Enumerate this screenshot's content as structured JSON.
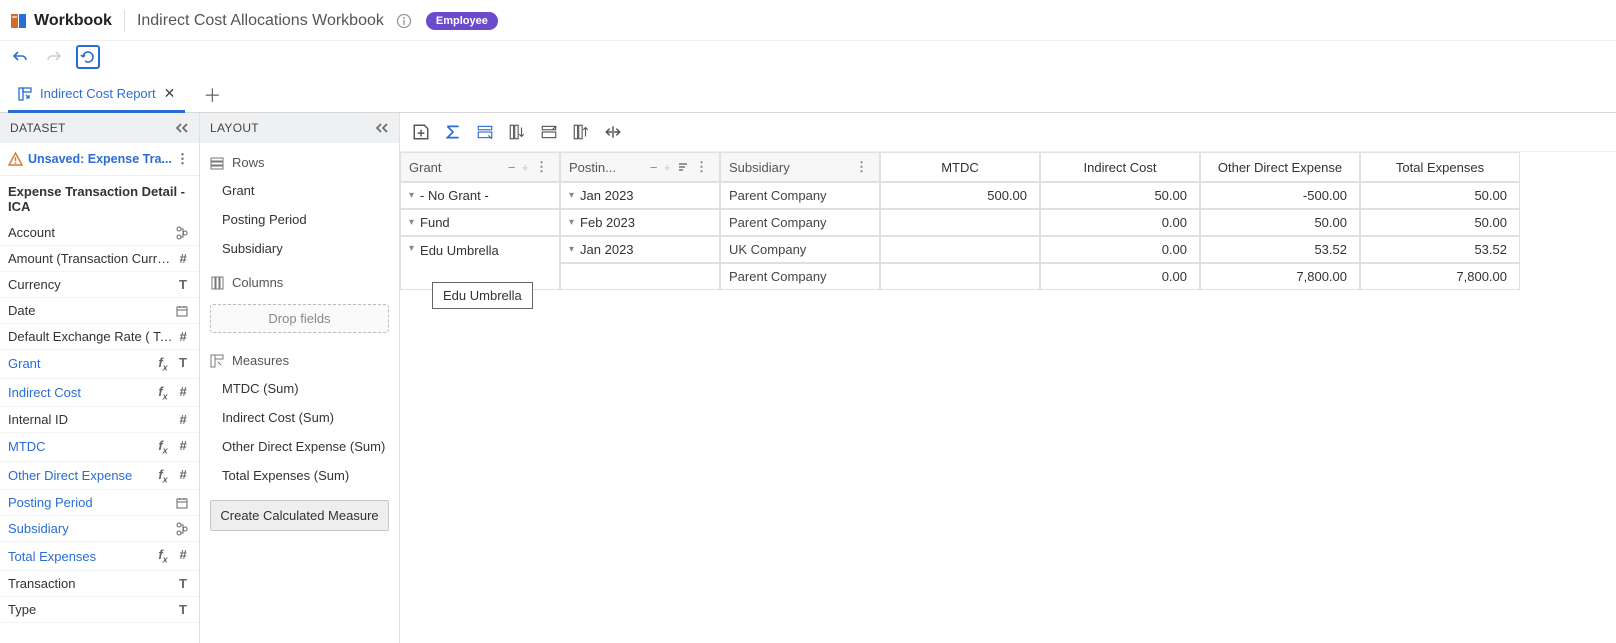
{
  "header": {
    "app_title": "Workbook",
    "workbook_title": "Indirect Cost Allocations Workbook",
    "role_badge": "Employee"
  },
  "tab": {
    "label": "Indirect Cost Report"
  },
  "panels": {
    "dataset_title": "DATASET",
    "layout_title": "LAYOUT"
  },
  "dataset": {
    "unsaved_label": "Unsaved: Expense Tra...",
    "source_title": "Expense Transaction Detail - ICA",
    "fields": [
      {
        "name": "Account",
        "used": false,
        "icons": [
          "hier"
        ]
      },
      {
        "name": "Amount (Transaction Curre...",
        "used": false,
        "icons": [
          "num"
        ]
      },
      {
        "name": "Currency",
        "used": false,
        "icons": [
          "text"
        ]
      },
      {
        "name": "Date",
        "used": false,
        "icons": [
          "date"
        ]
      },
      {
        "name": "Default Exchange Rate ( To...",
        "used": false,
        "icons": [
          "num"
        ]
      },
      {
        "name": "Grant",
        "used": true,
        "icons": [
          "fx",
          "text"
        ]
      },
      {
        "name": "Indirect Cost",
        "used": true,
        "icons": [
          "fx",
          "num"
        ]
      },
      {
        "name": "Internal ID",
        "used": false,
        "icons": [
          "num"
        ]
      },
      {
        "name": "MTDC",
        "used": true,
        "icons": [
          "fx",
          "num"
        ]
      },
      {
        "name": "Other Direct Expense",
        "used": true,
        "icons": [
          "fx",
          "num"
        ]
      },
      {
        "name": "Posting Period",
        "used": true,
        "icons": [
          "date"
        ]
      },
      {
        "name": "Subsidiary",
        "used": true,
        "icons": [
          "hier"
        ]
      },
      {
        "name": "Total Expenses",
        "used": true,
        "icons": [
          "fx",
          "num"
        ]
      },
      {
        "name": "Transaction",
        "used": false,
        "icons": [
          "text"
        ]
      },
      {
        "name": "Type",
        "used": false,
        "icons": [
          "text"
        ]
      }
    ]
  },
  "layout": {
    "rows_label": "Rows",
    "columns_label": "Columns",
    "measures_label": "Measures",
    "drop_label": "Drop fields",
    "calc_btn": "Create Calculated Measure",
    "rows": [
      "Grant",
      "Posting Period",
      "Subsidiary"
    ],
    "measures": [
      "MTDC  (Sum)",
      "Indirect Cost  (Sum)",
      "Other Direct Expense  (Sum)",
      "Total Expenses  (Sum)"
    ]
  },
  "pivot": {
    "dim_headers": [
      "Grant",
      "Postin...",
      "Subsidiary"
    ],
    "measure_headers": [
      "MTDC",
      "Indirect Cost",
      "Other Direct Expense",
      "Total Expenses"
    ],
    "rows": [
      {
        "grant": "- No Grant -",
        "period": "Jan 2023",
        "subsidiary": "Parent Company",
        "mtdc": "500.00",
        "indirect": "50.00",
        "other": "-500.00",
        "total": "50.00"
      },
      {
        "grant": "Fund",
        "period": "Feb 2023",
        "subsidiary": "Parent Company",
        "mtdc": "",
        "indirect": "0.00",
        "other": "50.00",
        "total": "50.00"
      },
      {
        "grant": "Edu Umbrella",
        "period": "Jan 2023",
        "subsidiary": "UK Company",
        "mtdc": "",
        "indirect": "0.00",
        "other": "53.52",
        "total": "53.52"
      },
      {
        "grant": "",
        "period": "",
        "subsidiary": "Parent Company",
        "mtdc": "",
        "indirect": "0.00",
        "other": "7,800.00",
        "total": "7,800.00"
      }
    ],
    "tooltip": "Edu Umbrella"
  }
}
